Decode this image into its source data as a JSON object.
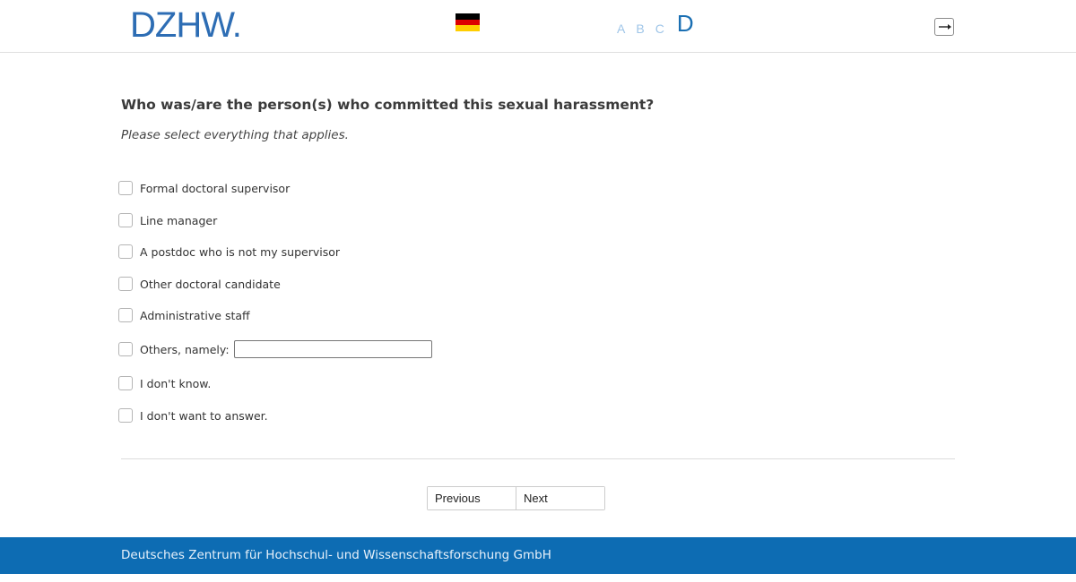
{
  "header": {
    "logo_text": "DZHW",
    "logo_dot": ".",
    "language_flag": {
      "icon": "german-flag-icon",
      "colors": [
        "#000000",
        "#dd0000",
        "#ffce00"
      ]
    },
    "font_sizes": [
      "A",
      "B",
      "C",
      "D"
    ],
    "exit_icon": "exit-icon"
  },
  "question": {
    "title": "Who was/are the person(s) who committed this sexual harassment?",
    "instruction": "Please select everything that applies."
  },
  "options": [
    {
      "label": "Formal doctoral supervisor",
      "checked": false
    },
    {
      "label": "Line manager",
      "checked": false
    },
    {
      "label": "A postdoc who is not my supervisor",
      "checked": false
    },
    {
      "label": "Other doctoral candidate",
      "checked": false
    },
    {
      "label": "Administrative staff",
      "checked": false
    },
    {
      "label": "Others, namely:",
      "checked": false,
      "input_value": ""
    },
    {
      "label": "I don't know.",
      "checked": false
    },
    {
      "label": "I don't want to answer.",
      "checked": false
    }
  ],
  "navigation": {
    "previous_label": "Previous",
    "next_label": "Next"
  },
  "footer": {
    "text": "Deutsches Zentrum für Hochschul- und Wissenschaftsforschung GmbH"
  },
  "colors": {
    "brand": "#2d6db4",
    "footer_bg": "#0d6cb3"
  }
}
